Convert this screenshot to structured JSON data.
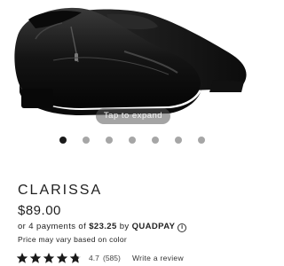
{
  "gallery": {
    "expand_label": "Tap to expand",
    "image_count": 7,
    "active_index": 0,
    "product_image": "black-leather-slip-on-shoes"
  },
  "product": {
    "name": "CLARISSA",
    "price": "$89.00"
  },
  "payment": {
    "prefix": "or 4 payments of ",
    "amount": "$23.25",
    "middle": " by ",
    "provider": "QUADPAY",
    "info_icon": "i"
  },
  "price_note": "Price may vary based on color",
  "rating": {
    "value": "4.7",
    "count": "(585)",
    "stars": 4.7,
    "write_review": "Write a review"
  },
  "colors": {
    "text": "#1f1f1f",
    "dot_active": "#1a1a1a",
    "dot_inactive": "#a6a6a6"
  }
}
